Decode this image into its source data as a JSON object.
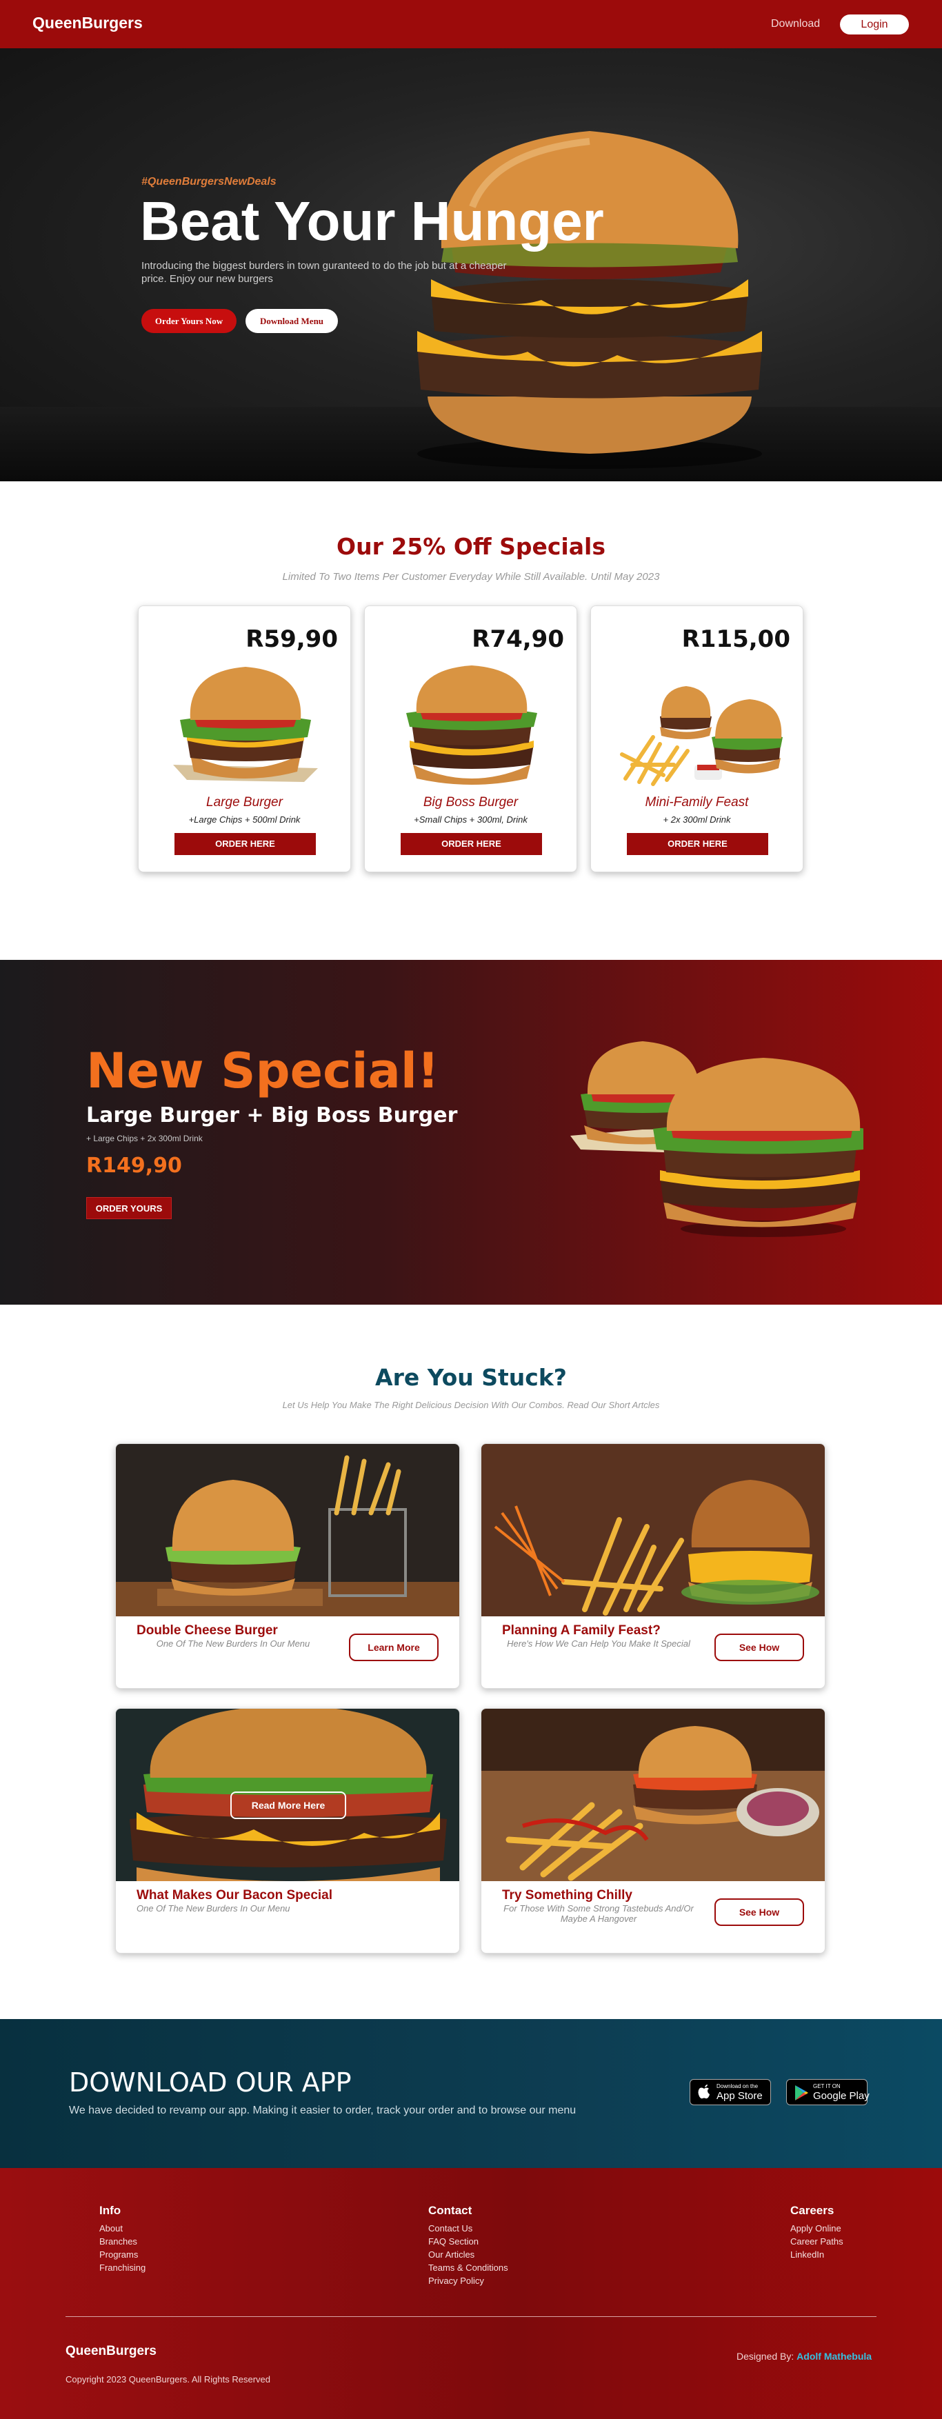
{
  "nav": {
    "brand": "QueenBurgers",
    "download": "Download",
    "login": "Login"
  },
  "hero": {
    "tag": "#QueenBurgersNewDeals",
    "title": "Beat Your Hunger",
    "desc": "Introducing the biggest burders in town guranteed to do the job but at a cheaper price. Enjoy our new burgers",
    "btn_order": "Order Yours Now",
    "btn_menu": "Download Menu"
  },
  "specials": {
    "title": "Our 25% Off Specials",
    "subtitle": "Limited To Two Items Per Customer Everyday While Still Available. Until May 2023",
    "cards": [
      {
        "price": "R59,90",
        "name": "Large Burger",
        "desc": "+Large Chips + 500ml Drink",
        "btn": "ORDER HERE"
      },
      {
        "price": "R74,90",
        "name": "Big Boss Burger",
        "desc": "+Small Chips + 300ml, Drink",
        "btn": "ORDER HERE"
      },
      {
        "price": "R115,00",
        "name": "Mini-Family Feast",
        "desc": "+ 2x 300ml Drink",
        "btn": "ORDER HERE"
      }
    ]
  },
  "new_special": {
    "title": "New Special!",
    "combo": "Large Burger + Big Boss Burger",
    "desc": "+ Large Chips + 2x 300ml Drink",
    "price": "R149,90",
    "btn": "ORDER YOURS"
  },
  "stuck": {
    "title": "Are You Stuck?",
    "subtitle": "Let Us Help You Make The Right Delicious Decision With Our Combos. Read Our Short Artcles",
    "articles": [
      {
        "title": "Double Cheese Burger",
        "sub": "One Of The New Burders In Our Menu",
        "btn": "Learn More"
      },
      {
        "title": "Planning A Family Feast?",
        "sub": "Here's How We Can Help You Make It Special",
        "btn": "See How"
      },
      {
        "title": "What Makes Our Bacon Special",
        "sub": "One Of The New Burders In Our Menu",
        "btn": "Read More Here"
      },
      {
        "title": "Try Something Chilly",
        "sub": "For Those With Some Strong Tastebuds And/Or Maybe A Hangover",
        "btn": "See How"
      }
    ]
  },
  "app": {
    "title": "DOWNLOAD OUR APP",
    "desc": "We have decided to revamp our app. Making it easier to order, track your order and to browse our menu",
    "apple_small": "Download on the",
    "apple_big": "App Store",
    "google_small": "GET IT ON",
    "google_big": "Google Play"
  },
  "footer": {
    "info": {
      "title": "Info",
      "links": [
        "About",
        "Branches",
        "Programs",
        "Franchising"
      ]
    },
    "contact": {
      "title": "Contact",
      "links": [
        "Contact Us",
        "FAQ Section",
        "Our Articles",
        "Teams & Conditions",
        "Privacy Policy"
      ]
    },
    "careers": {
      "title": "Careers",
      "links": [
        "Apply Online",
        "Career Paths",
        "LinkedIn"
      ]
    },
    "brand": "QueenBurgers",
    "copyright": "Copyright 2023 QueenBurgers. All Rights Reserved",
    "designed_label": "Designed By:",
    "designer": "Adolf Mathebula"
  },
  "colors": {
    "brand_red": "#9c0b0b",
    "accent_orange": "#f3701e",
    "app_teal": "#0d3d52"
  }
}
